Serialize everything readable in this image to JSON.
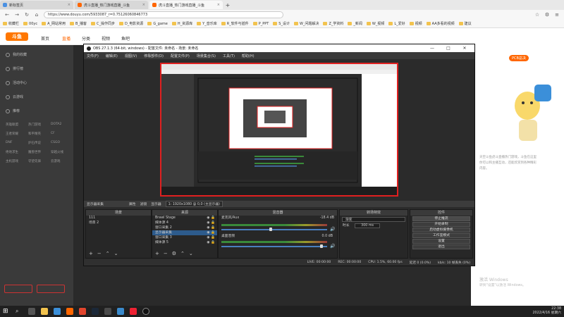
{
  "tabs": [
    {
      "label": "新标签页"
    },
    {
      "label": "虎斗直播_热门游戏直播_斗鱼"
    },
    {
      "label": "虎斗直播_热门游戏直播_斗鱼"
    }
  ],
  "url": "https://www.douyu.com/5933087_r=0.75126060846773",
  "bookmarks": [
    "收藏栏",
    "00yc",
    "A_网站常用",
    "B_播客",
    "C_操作同步",
    "D_电影资源",
    "G_game",
    "H_资源库",
    "Y_音乐库",
    "R_软件与插件",
    "P_PPT",
    "S_设计",
    "W_问题解决",
    "Z_学资料",
    "_新闻",
    "W_视频",
    "L_爱好",
    "视频",
    "AA多看的视频",
    "建议"
  ],
  "douyu": {
    "logo": "斗鱼",
    "nav": [
      "首页",
      "直播",
      "分类",
      "视频",
      "鱼吧"
    ],
    "sidebar": [
      {
        "label": "我的收藏"
      },
      {
        "label": "排行榜"
      },
      {
        "label": "活动中心"
      },
      {
        "label": "云游戏"
      },
      {
        "label": "推荐"
      }
    ],
    "categories": [
      "英雄联盟",
      "热门游戏",
      "DOTA2",
      "王者荣耀",
      "和平精英",
      "CF",
      "DNF",
      "炉石传说",
      "CSGO",
      "绝地求生",
      "魔兽世界",
      "穿越火线",
      "主机游戏",
      "守望先锋",
      "云游戏"
    ],
    "right_badge": "PCB总决",
    "right_text": "天空斗鱼虎斗直播热门游戏，斗鱼在这里你可以和主播互动，还能欣赏到各种精彩内容。"
  },
  "obs": {
    "title": "OBS 27.1.3 (64-bit, windows) - 配置文件: 未命名 - 场景: 未命名",
    "menu": [
      "文件(F)",
      "编辑(E)",
      "视图(V)",
      "停靠部件(D)",
      "配置文件(P)",
      "场景集合(S)",
      "工具(T)",
      "帮助(H)"
    ],
    "toolbar": {
      "scene_label": "显示器采集",
      "properties": "属性",
      "filters": "滤镜",
      "display": "显示器",
      "res": "1: 1920x1080 @ 0,0 (主显示器)"
    },
    "docks": {
      "scenes": {
        "title": "场景",
        "items": [
          "111",
          "场景 2"
        ]
      },
      "sources": {
        "title": "来源",
        "items": [
          "Brawl Stage",
          "媒体源 4",
          "窗口采集 2",
          "显示器采集",
          "窗口采集 3",
          "媒体源 5"
        ]
      },
      "mixer": {
        "title": "混音器",
        "tracks": [
          {
            "name": "麦克风/Aux",
            "db": "-18.4 dB"
          },
          {
            "name": "桌面音频",
            "db": "0.0 dB"
          }
        ]
      },
      "transitions": {
        "title": "转场特效",
        "type": "渐变",
        "duration_label": "时长",
        "duration": "300 ms"
      },
      "controls": {
        "title": "控件",
        "buttons": [
          "停止推流",
          "开始录制",
          "启动虚拟摄像机",
          "工作室模式",
          "设置",
          "退出"
        ]
      }
    },
    "status": {
      "live": "LIVE: 00:00:00",
      "rec": "REC: 00:00:00",
      "cpu": "CPU: 1.5%, 60.00 fps",
      "drop": "延迟 0 (0.0%)",
      "kbps": "kb/s: 10 帧丢失 (0%)"
    }
  },
  "watermark": {
    "line1": "激活 Windows",
    "line2": "转到\"设置\"以激活 Windows。"
  },
  "clock": {
    "time": "22:38",
    "date": "2022/4/16 星期六"
  }
}
